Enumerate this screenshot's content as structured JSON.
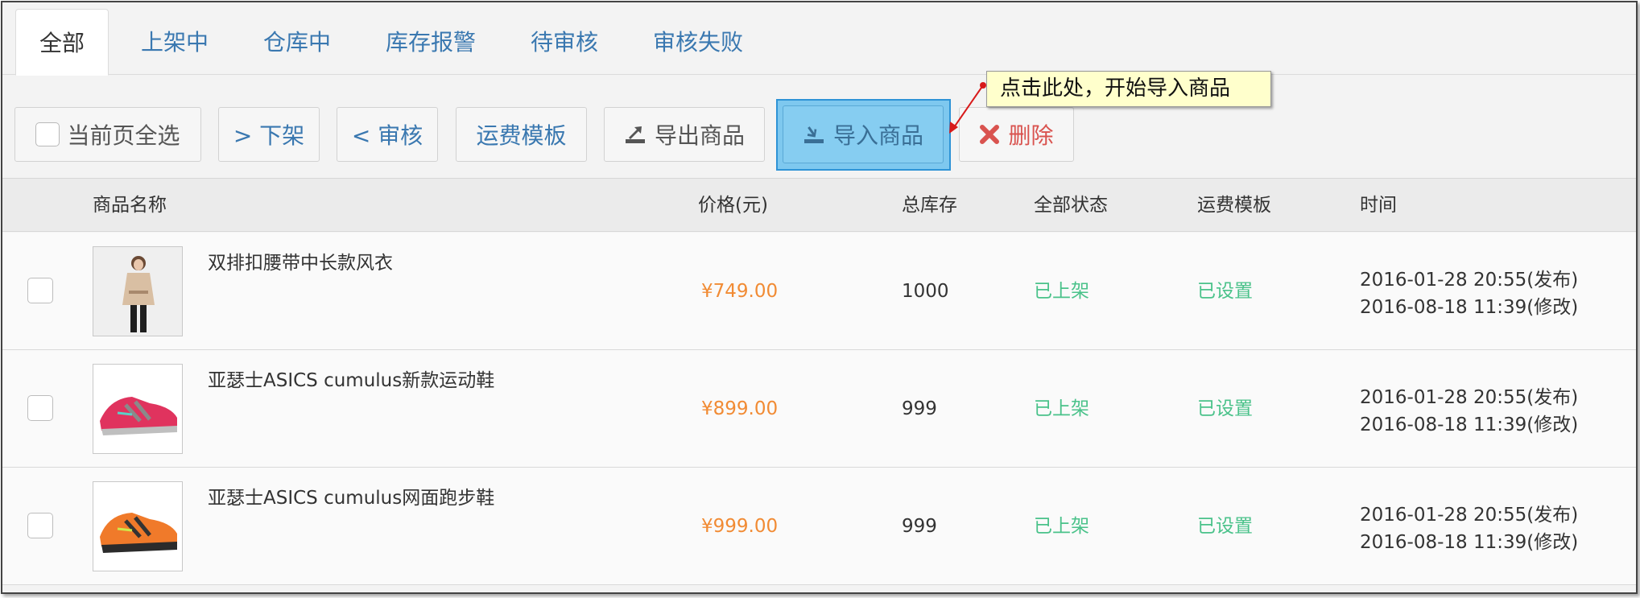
{
  "tabs": [
    {
      "label": "全部",
      "active": true
    },
    {
      "label": "上架中"
    },
    {
      "label": "仓库中"
    },
    {
      "label": "库存报警"
    },
    {
      "label": "待审核"
    },
    {
      "label": "审核失败"
    }
  ],
  "toolbar": {
    "select_all_label": "当前页全选",
    "offshelf_label": "> 下架",
    "review_label": "< 审核",
    "shipping_template_label": "运费模板",
    "export_label": "导出商品",
    "import_label": "导入商品",
    "delete_label": "删除"
  },
  "tooltip": {
    "text": "点击此处，开始导入商品"
  },
  "table": {
    "headers": {
      "name": "商品名称",
      "price": "价格(元)",
      "stock": "总库存",
      "status": "全部状态",
      "shipping": "运费模板",
      "time": "时间"
    },
    "rows": [
      {
        "name": "双排扣腰带中长款风衣",
        "price": "¥749.00",
        "stock": "1000",
        "status": "已上架",
        "shipping": "已设置",
        "published": "2016-01-28 20:55(发布)",
        "modified": "2016-08-18 11:39(修改)",
        "thumb": "coat-photo"
      },
      {
        "name": "亚瑟士ASICS cumulus新款运动鞋",
        "price": "¥899.00",
        "stock": "999",
        "status": "已上架",
        "shipping": "已设置",
        "published": "2016-01-28 20:55(发布)",
        "modified": "2016-08-18 11:39(修改)",
        "thumb": "pink-shoe-photo"
      },
      {
        "name": "亚瑟士ASICS cumulus网面跑步鞋",
        "price": "¥999.00",
        "stock": "999",
        "status": "已上架",
        "shipping": "已设置",
        "published": "2016-01-28 20:55(发布)",
        "modified": "2016-08-18 11:39(修改)",
        "thumb": "orange-shoe-photo"
      }
    ]
  },
  "colors": {
    "link": "#3a78b0",
    "price": "#f18b34",
    "status_green": "#4ac28a",
    "delete_red": "#d9534f",
    "highlight_blue": "#7ec8ef",
    "tooltip_bg": "#ffffcc"
  }
}
